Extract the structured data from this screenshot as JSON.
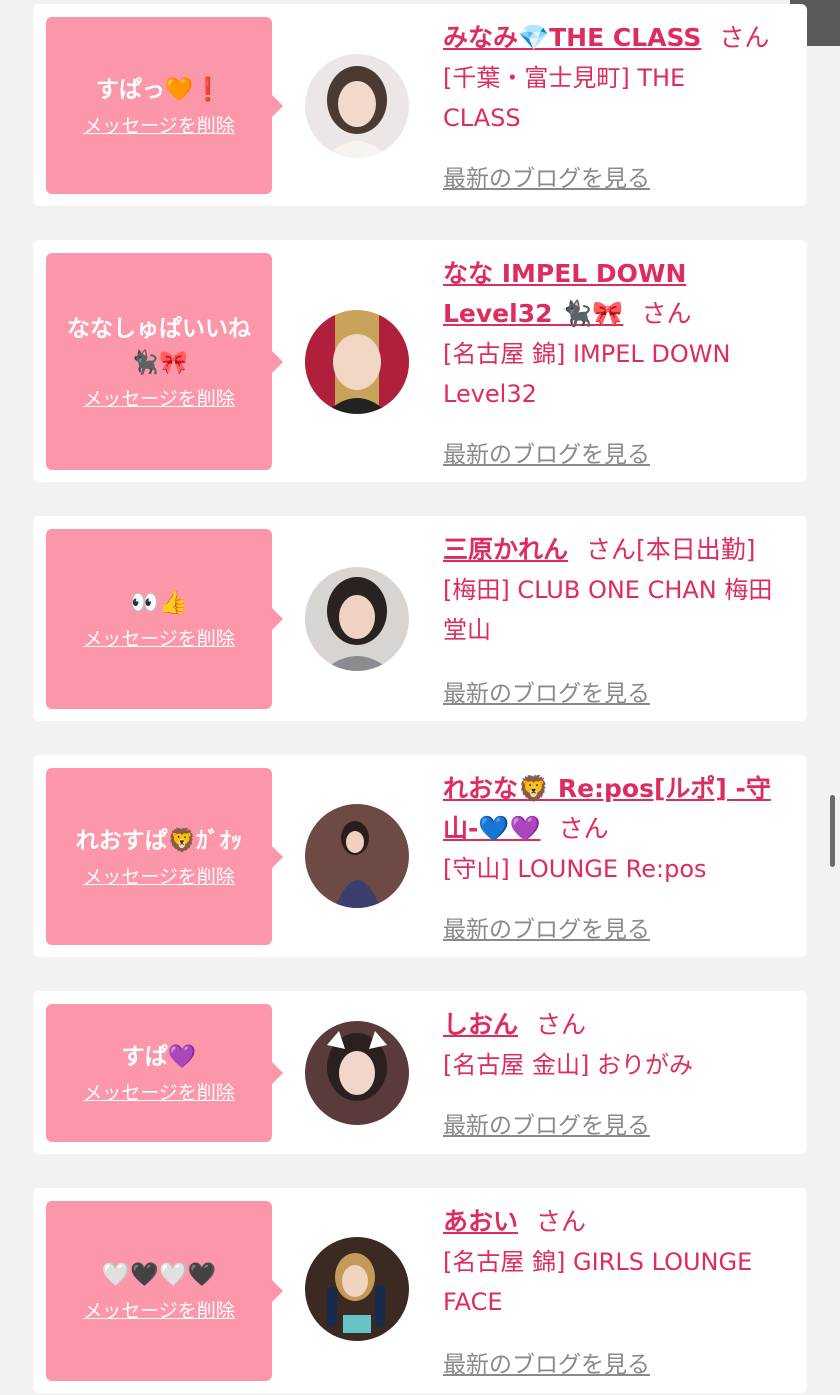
{
  "accent_color": "#dd2c5e",
  "bubble_color": "#fc96a9",
  "cards": [
    {
      "message": "すぱっ🧡❗️",
      "delete_label": "メッセージを削除",
      "name": "みなみ💎THE CLASS",
      "suffix": "さん",
      "shop": "[千葉・富士見町] THE CLASS",
      "blog_label": "最新のブログを見る"
    },
    {
      "message": "ななしゅぱいいね🐈‍⬛🎀",
      "delete_label": "メッセージを削除",
      "name": "なな IMPEL DOWN Level32 🐈‍⬛🎀",
      "suffix": "さん",
      "shop": "[名古屋 錦] IMPEL DOWN Level32",
      "blog_label": "最新のブログを見る"
    },
    {
      "message": "👀👍",
      "delete_label": "メッセージを削除",
      "name": "三原かれん",
      "suffix": "さん[本日出勤]",
      "shop": "[梅田] CLUB ONE CHAN 梅田堂山",
      "blog_label": "最新のブログを見る"
    },
    {
      "message": "れおすぱ🦁ｶﾞｵｯ",
      "delete_label": "メッセージを削除",
      "name": "れおな🦁 Re:pos[ルポ] -守山-💙💜",
      "suffix": "さん",
      "shop": "[守山] LOUNGE Re:pos",
      "blog_label": "最新のブログを見る"
    },
    {
      "message": "すぱ💜",
      "delete_label": "メッセージを削除",
      "name": "しおん",
      "suffix": "さん",
      "shop": "[名古屋 金山] おりがみ",
      "blog_label": "最新のブログを見る"
    },
    {
      "message": "🤍🖤🤍🖤",
      "delete_label": "メッセージを削除",
      "name": "あおい",
      "suffix": "さん",
      "shop": "[名古屋 錦] GIRLS LOUNGE FACE",
      "blog_label": "最新のブログを見る"
    }
  ]
}
